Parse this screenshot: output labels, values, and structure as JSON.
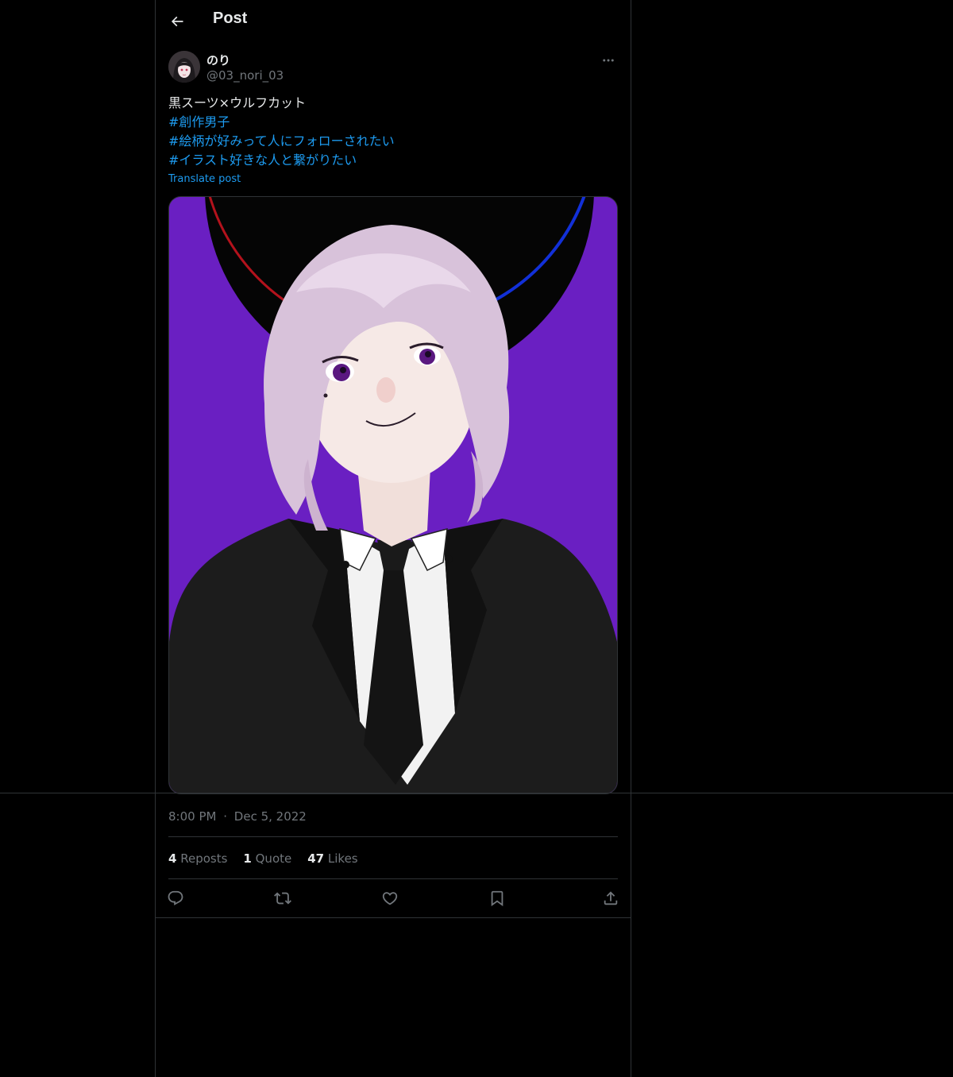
{
  "header": {
    "title": "Post",
    "back_icon": "arrow-left-icon"
  },
  "author": {
    "display_name": "のり",
    "handle": "@03_nori_03",
    "more_icon": "more-icon"
  },
  "tweet": {
    "lines": [
      {
        "text": "黒スーツ×ウルフカット",
        "type": "text"
      },
      {
        "text": "#創作男子",
        "type": "hashtag"
      },
      {
        "text": "#絵柄が好みって人にフォローされたい",
        "type": "hashtag"
      },
      {
        "text": "#イラスト好きな人と繋がりたい",
        "type": "hashtag"
      }
    ],
    "translate_label": "Translate post",
    "media_colors": {
      "background": "#6a1fc2",
      "hair": "#d8c2da",
      "suit": "#1c1c1c",
      "shirt": "#f2f2f2"
    },
    "time": "8:00 PM",
    "dot": "·",
    "date": "Dec 5, 2022"
  },
  "stats": {
    "reposts_count": "4",
    "reposts_label": "Reposts",
    "quotes_count": "1",
    "quotes_label": "Quote",
    "likes_count": "47",
    "likes_label": "Likes"
  },
  "actions": [
    "reply-icon",
    "repost-icon",
    "like-icon",
    "bookmark-icon",
    "share-icon"
  ],
  "colors": {
    "accent": "#1d9bf0",
    "background": "#000000",
    "border": "#2f3336",
    "text_primary": "#e7e9ea",
    "text_secondary": "#71767b"
  }
}
